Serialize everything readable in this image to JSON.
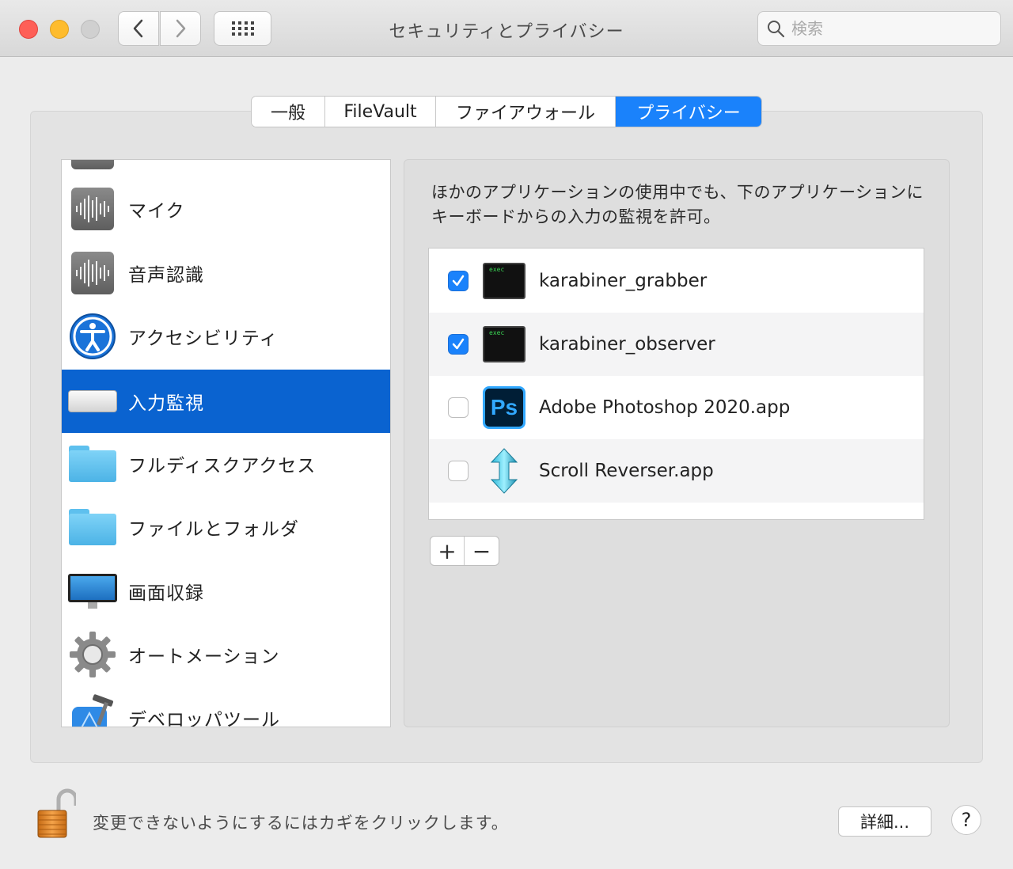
{
  "window": {
    "title": "セキュリティとプライバシー",
    "search_placeholder": "検索"
  },
  "tabs": [
    {
      "label": "一般",
      "active": false
    },
    {
      "label": "FileVault",
      "active": false
    },
    {
      "label": "ファイアウォール",
      "active": false
    },
    {
      "label": "プライバシー",
      "active": true
    }
  ],
  "sidebar": {
    "items": [
      {
        "label": "マイク",
        "icon": "microphone-icon"
      },
      {
        "label": "音声認識",
        "icon": "speech-recognition-icon"
      },
      {
        "label": "アクセシビリティ",
        "icon": "accessibility-icon"
      },
      {
        "label": "入力監視",
        "icon": "keyboard-icon",
        "selected": true
      },
      {
        "label": "フルディスクアクセス",
        "icon": "folder-icon"
      },
      {
        "label": "ファイルとフォルダ",
        "icon": "folder-icon"
      },
      {
        "label": "画面収録",
        "icon": "display-icon"
      },
      {
        "label": "オートメーション",
        "icon": "gear-icon"
      },
      {
        "label": "デベロッパツール",
        "icon": "xcode-icon"
      }
    ]
  },
  "main": {
    "description": "ほかのアプリケーションの使用中でも、下のアプリケーションにキーボードからの入力の監視を許可。",
    "apps": [
      {
        "name": "karabiner_grabber",
        "checked": true,
        "icon": "terminal-exec-icon",
        "icon_text": "exec"
      },
      {
        "name": "karabiner_observer",
        "checked": true,
        "icon": "terminal-exec-icon",
        "icon_text": "exec"
      },
      {
        "name": "Adobe Photoshop 2020.app",
        "checked": false,
        "icon": "photoshop-icon",
        "icon_text": "Ps"
      },
      {
        "name": "Scroll Reverser.app",
        "checked": false,
        "icon": "scroll-reverser-icon"
      }
    ],
    "add_label": "+",
    "remove_label": "−"
  },
  "footer": {
    "lock_text": "変更できないようにするにはカギをクリックします。",
    "details_label": "詳細...",
    "help_label": "?"
  },
  "colors": {
    "accent": "#1a82fb",
    "selection": "#0a63d0"
  }
}
